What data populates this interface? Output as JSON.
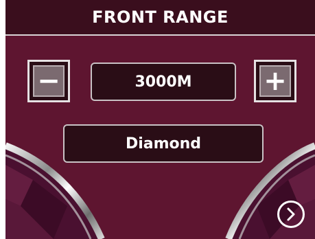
{
  "header": {
    "title": "FRONT RANGE"
  },
  "range": {
    "value": "3000M",
    "decrease_symbol": "−",
    "increase_symbol": "+"
  },
  "mode": {
    "value": "Diamond"
  },
  "icons": {
    "decrease": "minus-icon",
    "increase": "plus-icon",
    "next": "chevron-right-circle-icon"
  },
  "colors": {
    "panel_background": "#5e1530",
    "title_bar": "#3a0e1d",
    "field_background": "#2a0d16",
    "text": "#ffffff"
  }
}
